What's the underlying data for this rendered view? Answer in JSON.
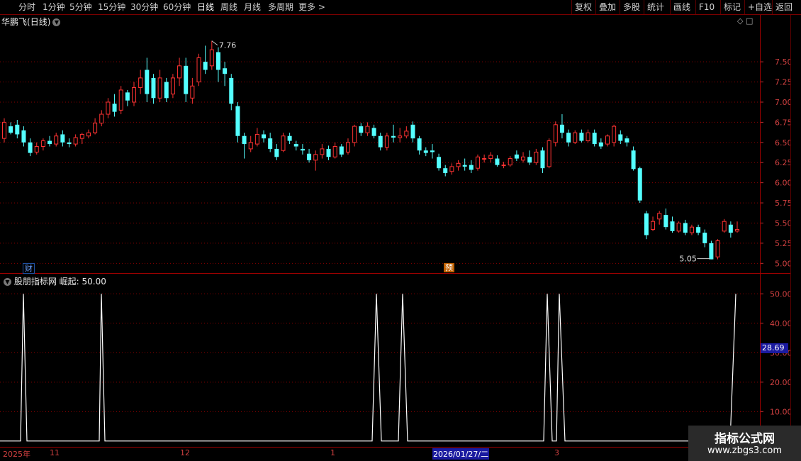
{
  "toolbar": {
    "periods": [
      "分时",
      "1分钟",
      "5分钟",
      "15分钟",
      "30分钟",
      "60分钟",
      "日线",
      "周线",
      "月线",
      "多周期",
      "更多 >"
    ],
    "active_period": "日线",
    "right_buttons": [
      "复权",
      "叠加",
      "多股",
      "统计",
      "画线",
      "F10",
      "标记",
      "+自选",
      "返回"
    ]
  },
  "stock": {
    "name": "华鹏飞",
    "period_label": "(日线)",
    "high_label": "7.76",
    "low_label": "5.05"
  },
  "indicator": {
    "name": "股朋指标网",
    "line_label": "崛起: 50.00",
    "current_value": "28.69"
  },
  "tags": {
    "cai": "财",
    "yu": "预"
  },
  "dates": {
    "year": "2025年",
    "m11": "11",
    "m12": "12",
    "m1": "1",
    "selected": "2026/01/27/二",
    "m3": "3"
  },
  "watermark": {
    "line1": "指标公式网",
    "line2": "www.zbgs3.com"
  },
  "colors": {
    "up": "#ff3232",
    "down": "#54ffff",
    "grid": "#8a0000",
    "axis": "#c03030"
  },
  "chart_data": [
    {
      "type": "candlestick",
      "yticks": [
        5.0,
        5.25,
        5.5,
        5.75,
        6.0,
        6.25,
        6.5,
        6.75,
        7.0,
        7.25,
        7.5
      ],
      "ylim": [
        4.95,
        7.95
      ],
      "annotations": [
        "7.76",
        "5.05"
      ],
      "candles": [
        [
          6.55,
          6.75,
          6.5,
          6.8
        ],
        [
          6.7,
          6.62,
          6.6,
          6.75
        ],
        [
          6.72,
          6.6,
          6.55,
          6.78
        ],
        [
          6.65,
          6.5,
          6.45,
          6.7
        ],
        [
          6.5,
          6.37,
          6.33,
          6.55
        ],
        [
          6.38,
          6.45,
          6.35,
          6.5
        ],
        [
          6.45,
          6.52,
          6.4,
          6.55
        ],
        [
          6.52,
          6.48,
          6.45,
          6.58
        ],
        [
          6.48,
          6.58,
          6.45,
          6.62
        ],
        [
          6.6,
          6.5,
          6.45,
          6.65
        ],
        [
          6.5,
          6.48,
          6.44,
          6.55
        ],
        [
          6.48,
          6.56,
          6.45,
          6.6
        ],
        [
          6.55,
          6.6,
          6.48,
          6.62
        ],
        [
          6.58,
          6.62,
          6.55,
          6.66
        ],
        [
          6.62,
          6.74,
          6.6,
          6.8
        ],
        [
          6.74,
          6.85,
          6.7,
          6.9
        ],
        [
          6.85,
          7.0,
          6.8,
          7.05
        ],
        [
          6.98,
          6.88,
          6.82,
          7.1
        ],
        [
          6.9,
          7.15,
          6.85,
          7.2
        ],
        [
          7.12,
          7.02,
          6.95,
          7.15
        ],
        [
          7.0,
          7.18,
          6.95,
          7.25
        ],
        [
          7.18,
          7.3,
          7.1,
          7.4
        ],
        [
          7.4,
          7.1,
          7.0,
          7.55
        ],
        [
          7.3,
          7.05,
          6.98,
          7.35
        ],
        [
          7.05,
          7.3,
          7.0,
          7.4
        ],
        [
          7.25,
          7.05,
          7.0,
          7.3
        ],
        [
          7.1,
          7.3,
          7.05,
          7.35
        ],
        [
          7.3,
          7.45,
          7.2,
          7.55
        ],
        [
          7.45,
          7.1,
          7.0,
          7.55
        ],
        [
          7.05,
          7.2,
          6.98,
          7.3
        ],
        [
          7.25,
          7.55,
          7.2,
          7.6
        ],
        [
          7.5,
          7.4,
          7.35,
          7.7
        ],
        [
          7.45,
          7.65,
          7.4,
          7.76
        ],
        [
          7.62,
          7.4,
          7.25,
          7.68
        ],
        [
          7.42,
          7.35,
          7.2,
          7.5
        ],
        [
          7.3,
          6.98,
          6.9,
          7.35
        ],
        [
          6.95,
          6.58,
          6.5,
          7.0
        ],
        [
          6.58,
          6.48,
          6.3,
          6.62
        ],
        [
          6.42,
          6.5,
          6.38,
          6.58
        ],
        [
          6.48,
          6.6,
          6.45,
          6.68
        ],
        [
          6.6,
          6.55,
          6.5,
          6.65
        ],
        [
          6.55,
          6.42,
          6.38,
          6.62
        ],
        [
          6.42,
          6.32,
          6.28,
          6.48
        ],
        [
          6.4,
          6.58,
          6.38,
          6.62
        ],
        [
          6.58,
          6.52,
          6.48,
          6.62
        ],
        [
          6.48,
          6.45,
          6.4,
          6.52
        ],
        [
          6.42,
          6.4,
          6.35,
          6.48
        ],
        [
          6.36,
          6.28,
          6.25,
          6.42
        ],
        [
          6.28,
          6.35,
          6.15,
          6.4
        ],
        [
          6.35,
          6.42,
          6.3,
          6.48
        ],
        [
          6.42,
          6.32,
          6.28,
          6.46
        ],
        [
          6.32,
          6.45,
          6.3,
          6.5
        ],
        [
          6.45,
          6.35,
          6.32,
          6.48
        ],
        [
          6.38,
          6.5,
          6.35,
          6.55
        ],
        [
          6.5,
          6.7,
          6.45,
          6.72
        ],
        [
          6.7,
          6.62,
          6.58,
          6.74
        ],
        [
          6.62,
          6.7,
          6.58,
          6.75
        ],
        [
          6.68,
          6.58,
          6.55,
          6.72
        ],
        [
          6.58,
          6.44,
          6.4,
          6.62
        ],
        [
          6.44,
          6.58,
          6.4,
          6.62
        ],
        [
          6.58,
          6.56,
          6.5,
          6.72
        ],
        [
          6.56,
          6.58,
          6.5,
          6.68
        ],
        [
          6.58,
          6.64,
          6.55,
          6.7
        ],
        [
          6.72,
          6.55,
          6.5,
          6.76
        ],
        [
          6.55,
          6.4,
          6.35,
          6.58
        ],
        [
          6.4,
          6.37,
          6.33,
          6.44
        ],
        [
          6.4,
          6.38,
          6.3,
          6.48
        ],
        [
          6.32,
          6.18,
          6.15,
          6.36
        ],
        [
          6.18,
          6.12,
          6.08,
          6.22
        ],
        [
          6.14,
          6.2,
          6.1,
          6.24
        ],
        [
          6.2,
          6.24,
          6.15,
          6.28
        ],
        [
          6.22,
          6.2,
          6.15,
          6.3
        ],
        [
          6.22,
          6.16,
          6.12,
          6.28
        ],
        [
          6.18,
          6.32,
          6.15,
          6.35
        ],
        [
          6.3,
          6.3,
          6.25,
          6.35
        ],
        [
          6.3,
          6.34,
          6.25,
          6.38
        ],
        [
          6.3,
          6.22,
          6.2,
          6.34
        ],
        [
          6.22,
          6.22,
          6.18,
          6.26
        ],
        [
          6.22,
          6.3,
          6.2,
          6.33
        ],
        [
          6.35,
          6.3,
          6.27,
          6.4
        ],
        [
          6.28,
          6.32,
          6.25,
          6.38
        ],
        [
          6.32,
          6.25,
          6.22,
          6.4
        ],
        [
          6.25,
          6.38,
          6.22,
          6.42
        ],
        [
          6.4,
          6.18,
          6.12,
          6.44
        ],
        [
          6.2,
          6.52,
          6.18,
          6.55
        ],
        [
          6.5,
          6.72,
          6.45,
          6.76
        ],
        [
          6.72,
          6.62,
          6.55,
          6.85
        ],
        [
          6.62,
          6.5,
          6.45,
          6.66
        ],
        [
          6.5,
          6.62,
          6.48,
          6.65
        ],
        [
          6.62,
          6.52,
          6.5,
          6.66
        ],
        [
          6.52,
          6.62,
          6.5,
          6.66
        ],
        [
          6.62,
          6.48,
          6.45,
          6.66
        ],
        [
          6.5,
          6.45,
          6.42,
          6.55
        ],
        [
          6.48,
          6.58,
          6.45,
          6.6
        ],
        [
          6.5,
          6.7,
          6.45,
          6.72
        ],
        [
          6.6,
          6.52,
          6.48,
          6.65
        ],
        [
          6.55,
          6.5,
          6.45,
          6.58
        ],
        [
          6.4,
          6.17,
          6.15,
          6.45
        ],
        [
          6.18,
          5.78,
          5.75,
          6.2
        ],
        [
          5.62,
          5.35,
          5.3,
          5.65
        ],
        [
          5.42,
          5.52,
          5.4,
          5.58
        ],
        [
          5.55,
          5.62,
          5.48,
          5.65
        ],
        [
          5.6,
          5.45,
          5.42,
          5.68
        ],
        [
          5.52,
          5.4,
          5.38,
          5.58
        ],
        [
          5.4,
          5.5,
          5.38,
          5.52
        ],
        [
          5.5,
          5.38,
          5.35,
          5.54
        ],
        [
          5.38,
          5.45,
          5.35,
          5.48
        ],
        [
          5.45,
          5.38,
          5.35,
          5.48
        ],
        [
          5.38,
          5.25,
          5.2,
          5.42
        ],
        [
          5.25,
          5.05,
          5.05,
          5.28
        ],
        [
          5.08,
          5.28,
          5.05,
          5.3
        ],
        [
          5.4,
          5.52,
          5.38,
          5.55
        ],
        [
          5.48,
          5.38,
          5.32,
          5.52
        ],
        [
          5.4,
          5.42,
          5.38,
          5.52
        ]
      ]
    },
    {
      "type": "line",
      "series_name": "崛起",
      "yticks": [
        10,
        20,
        30,
        40,
        50
      ],
      "ylim": [
        -1,
        52
      ],
      "points": [
        [
          0,
          0
        ],
        [
          29,
          0
        ],
        [
          33,
          50
        ],
        [
          38,
          0
        ],
        [
          140,
          0
        ],
        [
          143,
          50
        ],
        [
          148,
          0
        ],
        [
          525,
          0
        ],
        [
          531,
          50
        ],
        [
          538,
          0
        ],
        [
          562,
          0
        ],
        [
          568,
          50
        ],
        [
          575,
          0
        ],
        [
          767,
          0
        ],
        [
          772,
          50
        ],
        [
          779,
          0
        ],
        [
          785,
          0
        ],
        [
          789,
          50
        ],
        [
          797,
          0
        ],
        [
          1030,
          0
        ],
        [
          1038,
          50
        ]
      ]
    }
  ]
}
